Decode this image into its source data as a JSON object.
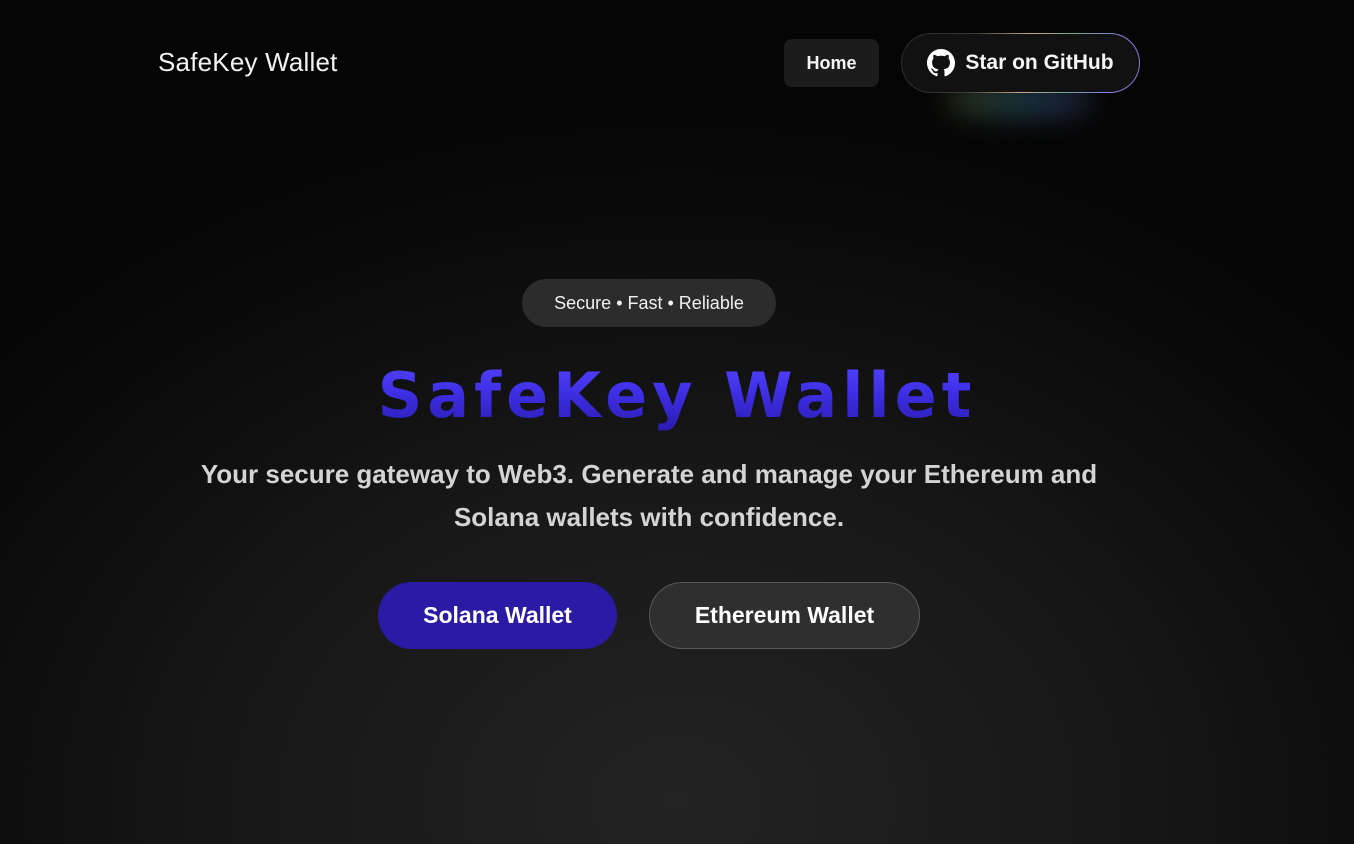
{
  "header": {
    "brand": "SafeKey Wallet",
    "nav_home": "Home",
    "github_button": "Star on GitHub",
    "github_icon": "github-icon"
  },
  "hero": {
    "badge": "Secure • Fast • Reliable",
    "title": "SafeKey Wallet",
    "subtitle": "Your secure gateway to Web3. Generate and manage your Ethereum and Solana wallets with confidence.",
    "primary_button": "Solana Wallet",
    "secondary_button": "Ethereum Wallet"
  },
  "colors": {
    "background": "#0b0b0b",
    "accent": "#3f2fe6",
    "primary_button": "#2a1aa6",
    "secondary_button": "#2f2f2f"
  }
}
